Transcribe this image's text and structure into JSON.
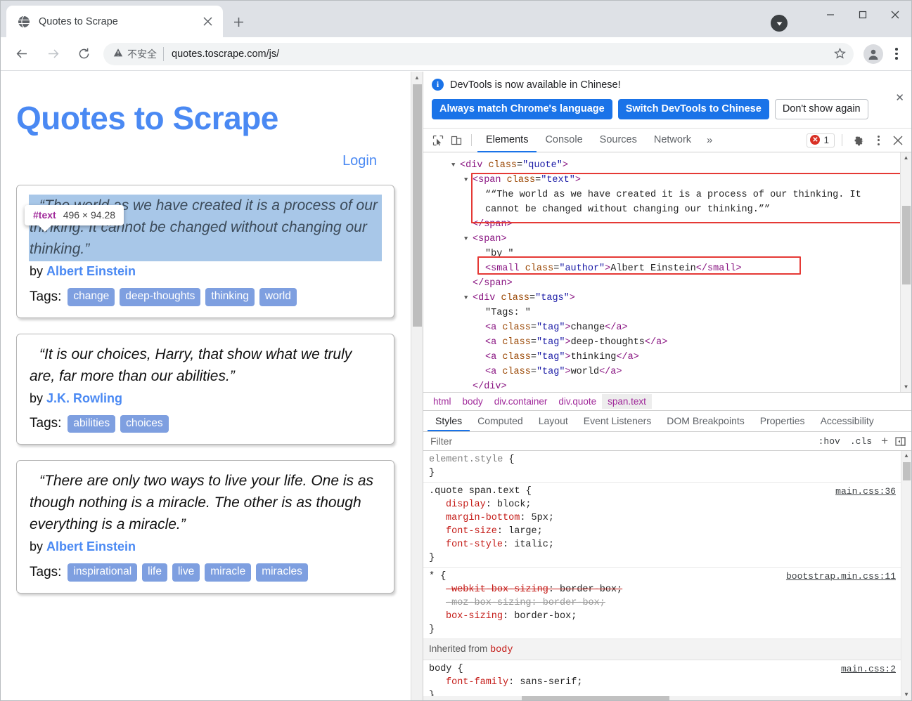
{
  "browser": {
    "tab": {
      "title": "Quotes to Scrape",
      "favicon": "globe-icon",
      "close": "×"
    },
    "newtab_label": "+",
    "window_controls": {
      "minimize": "—",
      "maximize": "☐",
      "close": "✕"
    },
    "nav": {
      "back": "←",
      "forward": "→",
      "reload": "⟳"
    },
    "omnibox": {
      "security_label": "不安全",
      "url": "quotes.toscrape.com/js/",
      "star": "☆"
    }
  },
  "page": {
    "site_title": "Quotes to Scrape",
    "login_label": "Login",
    "tags_label": "Tags:",
    "by_label": "by",
    "inspect_tooltip": {
      "node": "#text",
      "dims": "496 × 94.28"
    },
    "quotes": [
      {
        "text": "“The world as we have created it is a process of our thinking. It cannot be changed without changing our thinking.”",
        "author": "Albert Einstein",
        "tags": [
          "change",
          "deep-thoughts",
          "thinking",
          "world"
        ],
        "highlighted": true
      },
      {
        "text": "“It is our choices, Harry, that show what we truly are, far more than our abilities.”",
        "author": "J.K. Rowling",
        "tags": [
          "abilities",
          "choices"
        ],
        "highlighted": false
      },
      {
        "text": "“There are only two ways to live your life. One is as though nothing is a miracle. The other is as though everything is a miracle.”",
        "author": "Albert Einstein",
        "tags": [
          "inspirational",
          "life",
          "live",
          "miracle",
          "miracles"
        ],
        "highlighted": false
      }
    ]
  },
  "devtools": {
    "notice": {
      "message": "DevTools is now available in Chinese!",
      "btn_always": "Always match Chrome's language",
      "btn_switch": "Switch DevTools to Chinese",
      "btn_dismiss": "Don't show again",
      "close": "✕"
    },
    "tabs": [
      {
        "label": "Elements",
        "active": true
      },
      {
        "label": "Console",
        "active": false
      },
      {
        "label": "Sources",
        "active": false
      },
      {
        "label": "Network",
        "active": false
      }
    ],
    "more_tabs": "»",
    "error_count": "1",
    "dom_lines": [
      {
        "indent": 0,
        "tri": true,
        "parts": [
          [
            "punct",
            "<"
          ],
          [
            "tg",
            "div"
          ],
          [
            "at",
            " class"
          ],
          [
            "pn",
            "="
          ],
          [
            "av",
            "\"quote\""
          ],
          [
            "punct",
            ">"
          ]
        ]
      },
      {
        "indent": 1,
        "tri": true,
        "parts": [
          [
            "punct",
            "<"
          ],
          [
            "tg",
            "span"
          ],
          [
            "at",
            " class"
          ],
          [
            "pn",
            "="
          ],
          [
            "av",
            "\"text\""
          ],
          [
            "punct",
            ">"
          ]
        ]
      },
      {
        "indent": 2,
        "tri": false,
        "parts": [
          [
            "txt",
            "““The world as we have created it is a process of our thinking. It"
          ]
        ]
      },
      {
        "indent": 2,
        "tri": false,
        "parts": [
          [
            "txt",
            "cannot be changed without changing our thinking.””"
          ]
        ]
      },
      {
        "indent": 1,
        "tri": false,
        "parts": [
          [
            "punct",
            "</"
          ],
          [
            "tg",
            "span"
          ],
          [
            "punct",
            ">"
          ]
        ]
      },
      {
        "indent": 1,
        "tri": true,
        "parts": [
          [
            "punct",
            "<"
          ],
          [
            "tg",
            "span"
          ],
          [
            "punct",
            ">"
          ]
        ]
      },
      {
        "indent": 2,
        "tri": false,
        "parts": [
          [
            "txt",
            "\"by \""
          ]
        ]
      },
      {
        "indent": 2,
        "tri": false,
        "parts": [
          [
            "punct",
            "<"
          ],
          [
            "tg",
            "small"
          ],
          [
            "at",
            " class"
          ],
          [
            "pn",
            "="
          ],
          [
            "av",
            "\"author\""
          ],
          [
            "punct",
            ">"
          ],
          [
            "txt",
            "Albert Einstein"
          ],
          [
            "punct",
            "</"
          ],
          [
            "tg",
            "small"
          ],
          [
            "punct",
            ">"
          ]
        ]
      },
      {
        "indent": 1,
        "tri": false,
        "parts": [
          [
            "punct",
            "</"
          ],
          [
            "tg",
            "span"
          ],
          [
            "punct",
            ">"
          ]
        ]
      },
      {
        "indent": 1,
        "tri": true,
        "parts": [
          [
            "punct",
            "<"
          ],
          [
            "tg",
            "div"
          ],
          [
            "at",
            " class"
          ],
          [
            "pn",
            "="
          ],
          [
            "av",
            "\"tags\""
          ],
          [
            "punct",
            ">"
          ]
        ]
      },
      {
        "indent": 2,
        "tri": false,
        "parts": [
          [
            "txt",
            "\"Tags: \""
          ]
        ]
      },
      {
        "indent": 2,
        "tri": false,
        "parts": [
          [
            "punct",
            "<"
          ],
          [
            "tg",
            "a"
          ],
          [
            "at",
            " class"
          ],
          [
            "pn",
            "="
          ],
          [
            "av",
            "\"tag\""
          ],
          [
            "punct",
            ">"
          ],
          [
            "txt",
            "change"
          ],
          [
            "punct",
            "</"
          ],
          [
            "tg",
            "a"
          ],
          [
            "punct",
            ">"
          ]
        ]
      },
      {
        "indent": 2,
        "tri": false,
        "parts": [
          [
            "punct",
            "<"
          ],
          [
            "tg",
            "a"
          ],
          [
            "at",
            " class"
          ],
          [
            "pn",
            "="
          ],
          [
            "av",
            "\"tag\""
          ],
          [
            "punct",
            ">"
          ],
          [
            "txt",
            "deep-thoughts"
          ],
          [
            "punct",
            "</"
          ],
          [
            "tg",
            "a"
          ],
          [
            "punct",
            ">"
          ]
        ]
      },
      {
        "indent": 2,
        "tri": false,
        "parts": [
          [
            "punct",
            "<"
          ],
          [
            "tg",
            "a"
          ],
          [
            "at",
            " class"
          ],
          [
            "pn",
            "="
          ],
          [
            "av",
            "\"tag\""
          ],
          [
            "punct",
            ">"
          ],
          [
            "txt",
            "thinking"
          ],
          [
            "punct",
            "</"
          ],
          [
            "tg",
            "a"
          ],
          [
            "punct",
            ">"
          ]
        ]
      },
      {
        "indent": 2,
        "tri": false,
        "parts": [
          [
            "punct",
            "<"
          ],
          [
            "tg",
            "a"
          ],
          [
            "at",
            " class"
          ],
          [
            "pn",
            "="
          ],
          [
            "av",
            "\"tag\""
          ],
          [
            "punct",
            ">"
          ],
          [
            "txt",
            "world"
          ],
          [
            "punct",
            "</"
          ],
          [
            "tg",
            "a"
          ],
          [
            "punct",
            ">"
          ]
        ]
      },
      {
        "indent": 1,
        "tri": false,
        "parts": [
          [
            "punct",
            "</"
          ],
          [
            "tg",
            "div"
          ],
          [
            "punct",
            ">"
          ]
        ]
      }
    ],
    "breadcrumb": [
      {
        "label": "html",
        "selected": false
      },
      {
        "label": "body",
        "selected": false
      },
      {
        "label": "div.container",
        "selected": false
      },
      {
        "label": "div.quote",
        "selected": false
      },
      {
        "label": "span.text",
        "selected": true
      }
    ],
    "sidebar_tabs": [
      {
        "label": "Styles",
        "active": true
      },
      {
        "label": "Computed",
        "active": false
      },
      {
        "label": "Layout",
        "active": false
      },
      {
        "label": "Event Listeners",
        "active": false
      },
      {
        "label": "DOM Breakpoints",
        "active": false
      },
      {
        "label": "Properties",
        "active": false
      },
      {
        "label": "Accessibility",
        "active": false
      }
    ],
    "filter": {
      "placeholder": "Filter",
      "value": "",
      "hov": ":hov",
      "cls": ".cls",
      "plus": "+"
    },
    "style_rules": [
      {
        "selector": "element.style",
        "selector_style": "gray",
        "source": "",
        "props": []
      },
      {
        "selector": ".quote span.text",
        "selector_style": "dark",
        "source": "main.css:36",
        "props": [
          {
            "name": "display",
            "value": "block",
            "strike": false,
            "dim": false
          },
          {
            "name": "margin-bottom",
            "value": "5px",
            "strike": false,
            "dim": false
          },
          {
            "name": "font-size",
            "value": "large",
            "strike": false,
            "dim": false
          },
          {
            "name": "font-style",
            "value": "italic",
            "strike": false,
            "dim": false
          }
        ]
      },
      {
        "selector": "* ",
        "selector_style": "dark",
        "source": "bootstrap.min.css:11",
        "props": [
          {
            "name": "-webkit-box-sizing",
            "value": "border-box",
            "strike": true,
            "dim": false
          },
          {
            "name": "-moz-box-sizing",
            "value": "border-box",
            "strike": true,
            "dim": true
          },
          {
            "name": "box-sizing",
            "value": "border-box",
            "strike": false,
            "dim": false
          }
        ]
      }
    ],
    "inherited_label": "Inherited from",
    "inherited_from": "body",
    "inherited_rule": {
      "selector": "body",
      "source": "main.css:2",
      "props": [
        {
          "name": "font-family",
          "value": "sans-serif",
          "strike": false,
          "dim": false
        }
      ]
    }
  }
}
